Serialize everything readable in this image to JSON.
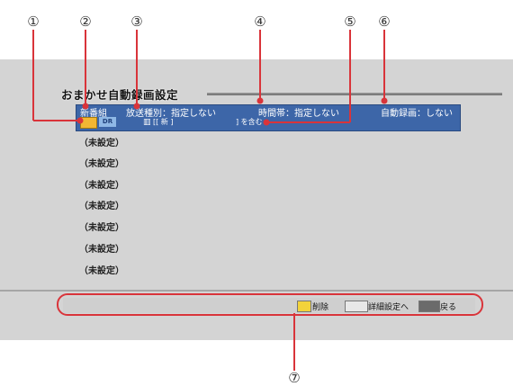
{
  "callouts": [
    "①",
    "②",
    "③",
    "④",
    "⑤",
    "⑥",
    "⑦"
  ],
  "title": "おまかせ自動録画設定",
  "selected_row": {
    "name": "新番組",
    "broadcast_type": "放送種別：指定しない",
    "time_slot": "時間帯：指定しない",
    "auto_record": "自動録画：しない",
    "badge_dr": "DR",
    "keyword_open": "[[ 新 ]",
    "keyword_close": "] を含む"
  },
  "empty_rows": [
    "（未設定）",
    "（未設定）",
    "（未設定）",
    "（未設定）",
    "（未設定）",
    "（未設定）",
    "（未設定）"
  ],
  "footer": {
    "delete_label": "削除",
    "detail_label": "詳細設定へ",
    "back_label": "戻る"
  },
  "colors": {
    "accent_red": "#d9343a",
    "row_blue": "#3d66a8",
    "badge_yellow": "#f2b733"
  }
}
